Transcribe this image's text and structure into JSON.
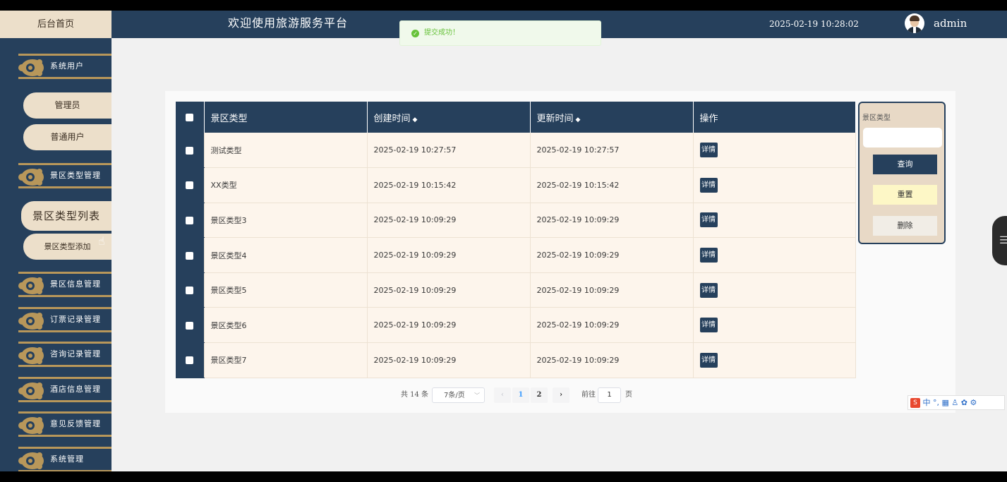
{
  "header": {
    "home_tab": "后台首页",
    "site_title": "欢迎使用旅游服务平台",
    "clock": "2025-02-19 10:28:02",
    "username": "admin"
  },
  "toast": {
    "message": "提交成功！",
    "icon": "check-circle-icon",
    "color": "#67c23a"
  },
  "sidebar": {
    "menus": [
      {
        "label": "系统用户"
      },
      {
        "label": "景区类型管理"
      },
      {
        "label": "景区信息管理"
      },
      {
        "label": "订票记录管理"
      },
      {
        "label": "咨询记录管理"
      },
      {
        "label": "酒店信息管理"
      },
      {
        "label": "意见反馈管理"
      },
      {
        "label": "系统管理"
      }
    ],
    "subs": [
      {
        "label": "管理员"
      },
      {
        "label": "普通用户"
      },
      {
        "label": "景区类型列表"
      },
      {
        "label": "景区类型添加"
      }
    ]
  },
  "table": {
    "headers": {
      "type": "景区类型",
      "created": "创建时间",
      "updated": "更新时间",
      "actions": "操作"
    },
    "detail_label": "详情",
    "rows": [
      {
        "type": "测试类型",
        "created": "2025-02-19 10:27:57",
        "updated": "2025-02-19 10:27:57"
      },
      {
        "type": "XX类型",
        "created": "2025-02-19 10:15:42",
        "updated": "2025-02-19 10:15:42"
      },
      {
        "type": "景区类型3",
        "created": "2025-02-19 10:09:29",
        "updated": "2025-02-19 10:09:29"
      },
      {
        "type": "景区类型4",
        "created": "2025-02-19 10:09:29",
        "updated": "2025-02-19 10:09:29"
      },
      {
        "type": "景区类型5",
        "created": "2025-02-19 10:09:29",
        "updated": "2025-02-19 10:09:29"
      },
      {
        "type": "景区类型6",
        "created": "2025-02-19 10:09:29",
        "updated": "2025-02-19 10:09:29"
      },
      {
        "type": "景区类型7",
        "created": "2025-02-19 10:09:29",
        "updated": "2025-02-19 10:09:29"
      }
    ]
  },
  "pagination": {
    "total": "共 14 条",
    "page_size": "7条/页",
    "pages": [
      "1",
      "2"
    ],
    "current_page": "1",
    "goto_label": "前往",
    "goto_value": "1",
    "page_suffix": "页"
  },
  "search": {
    "label": "景区类型",
    "value": "",
    "query_label": "查询",
    "reset_label": "重置",
    "delete_label": "删除"
  },
  "ime": {
    "logo": "S",
    "mode": "中"
  },
  "colors": {
    "primary": "#26405c",
    "cream": "#ecdfca",
    "gold": "#b8975a",
    "row_bg": "#fdf5ec"
  }
}
